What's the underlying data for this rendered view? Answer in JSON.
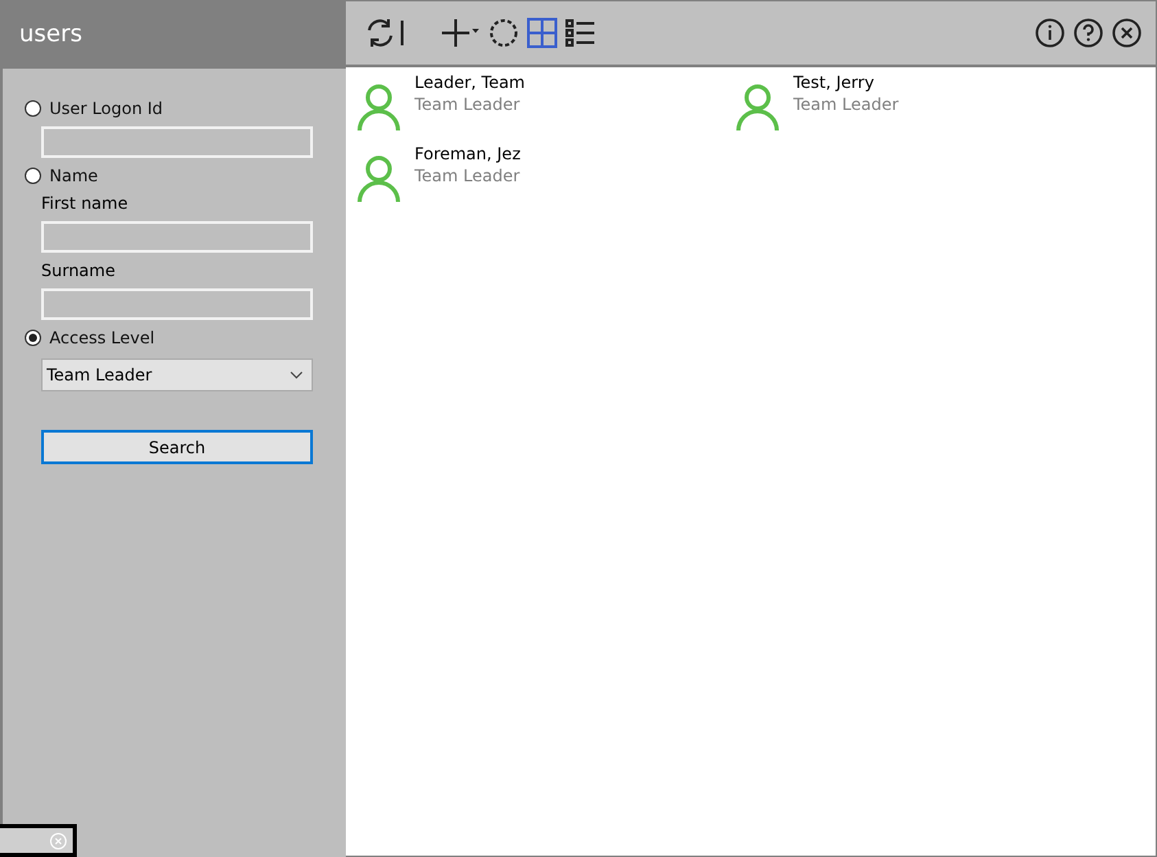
{
  "sidebar": {
    "title": "users",
    "options": [
      {
        "kind": "text",
        "label": "User Logon Id",
        "selected": false,
        "fields": [
          {
            "kind": "plain"
          }
        ]
      },
      {
        "kind": "name",
        "label": "Name",
        "selected": false,
        "fields": [
          {
            "kind": "labeled",
            "label": "First name"
          },
          {
            "kind": "labeled",
            "label": "Surname"
          }
        ]
      },
      {
        "kind": "select",
        "label": "Access Level",
        "selected": true,
        "value": "Team Leader"
      }
    ],
    "search_button": "Search"
  },
  "toolbar": {
    "view_modes": [
      {
        "kind": "grid",
        "selected": true
      },
      {
        "kind": "list",
        "selected": false
      }
    ]
  },
  "users": [
    {
      "name": "Leader, Team",
      "role": "Team Leader"
    },
    {
      "name": "Test, Jerry",
      "role": "Team Leader"
    },
    {
      "name": "Foreman, Jez",
      "role": "Team Leader"
    }
  ]
}
